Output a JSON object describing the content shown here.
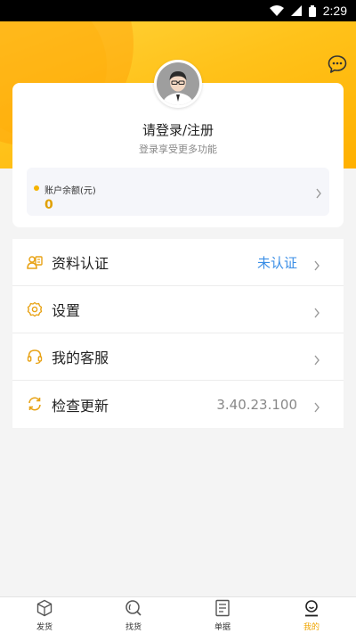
{
  "status_bar": {
    "time": "2:29",
    "icons": [
      "wifi-icon",
      "signal-icon",
      "battery-icon"
    ]
  },
  "header": {
    "chat_icon": "chat-bubble-icon"
  },
  "profile": {
    "avatar_icon": "user-avatar-icon",
    "login_text": "请登录/注册",
    "login_subtext": "登录享受更多功能"
  },
  "balance": {
    "label": "账户余额(元)",
    "value": "0"
  },
  "menu": {
    "items": [
      {
        "label": "资料认证",
        "value": "未认证",
        "icon": "id-card-icon"
      },
      {
        "label": "设置",
        "value": "",
        "icon": "gear-icon"
      },
      {
        "label": "我的客服",
        "value": "",
        "icon": "headset-icon"
      },
      {
        "label": "检查更新",
        "value": "3.40.23.100",
        "icon": "refresh-icon"
      }
    ]
  },
  "bottom_nav": {
    "items": [
      {
        "label": "发货",
        "icon": "box-icon"
      },
      {
        "label": "找货",
        "icon": "search-icon"
      },
      {
        "label": "单据",
        "icon": "document-icon"
      },
      {
        "label": "我的",
        "icon": "user-icon"
      }
    ],
    "active": "我的"
  },
  "colors": {
    "accent": "#ffc21a",
    "active_nav": "#f0a500",
    "link": "#3a8ee6",
    "icon": "#e8a317"
  }
}
